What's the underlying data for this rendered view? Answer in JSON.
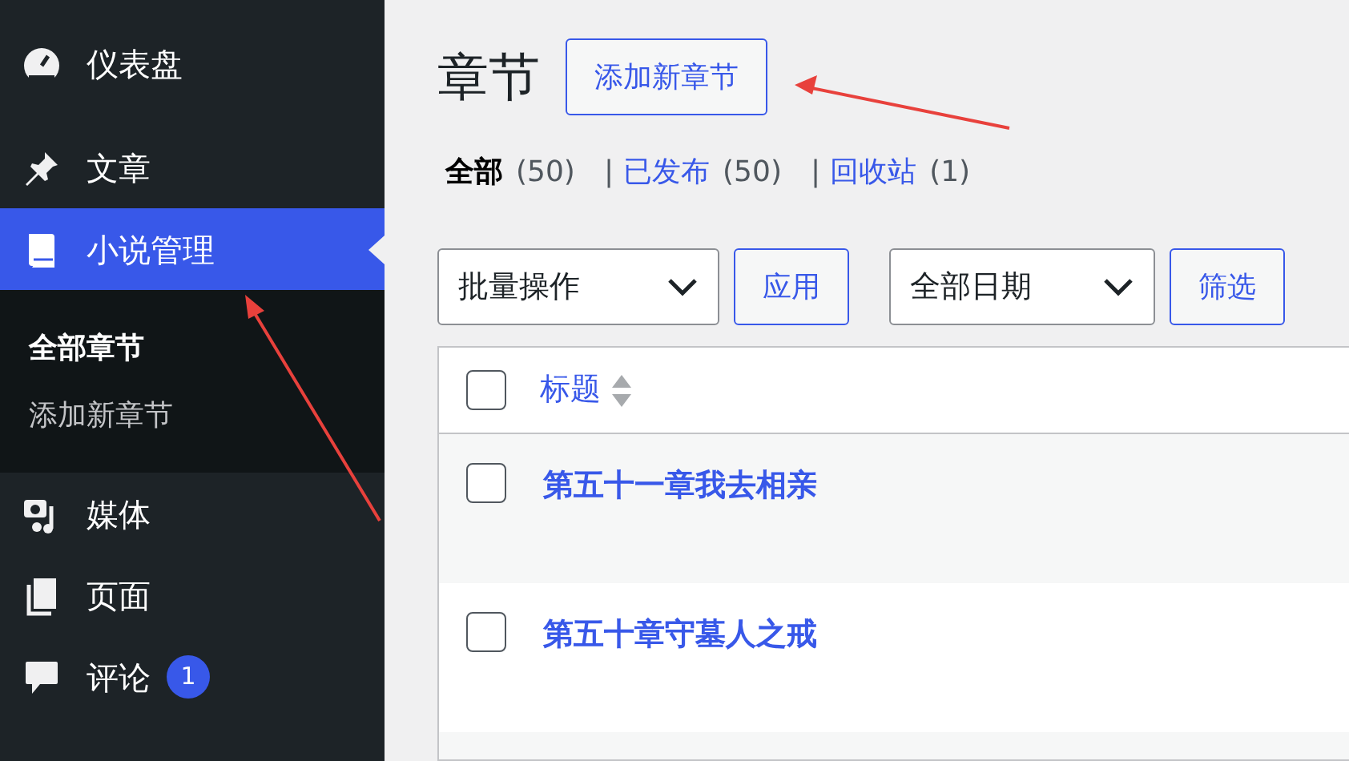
{
  "sidebar": {
    "items": [
      {
        "label": "仪表盘",
        "kind": "dashboard",
        "selected": false
      },
      {
        "label": "文章",
        "kind": "pin",
        "selected": false
      },
      {
        "label": "小说管理",
        "kind": "book",
        "selected": true,
        "submenu": [
          {
            "label": "全部章节",
            "selected": true
          },
          {
            "label": "添加新章节",
            "selected": false
          }
        ]
      },
      {
        "label": "媒体",
        "kind": "media",
        "selected": false
      },
      {
        "label": "页面",
        "kind": "pages",
        "selected": false
      },
      {
        "label": "评论",
        "kind": "comment",
        "selected": false,
        "badge": "1"
      }
    ]
  },
  "page": {
    "title": "章节",
    "add_button": "添加新章节"
  },
  "views": [
    {
      "label": "全部",
      "count": "(50)",
      "selected": true
    },
    {
      "separator": "|",
      "label": "已发布",
      "count": "(50)",
      "selected": false
    },
    {
      "separator": "|",
      "label": "回收站",
      "count": "(1)",
      "selected": false
    }
  ],
  "bulk_actions": {
    "select": "批量操作",
    "button": "应用"
  },
  "date_filter": {
    "select": "全部日期",
    "button": "筛选"
  },
  "table": {
    "select_all_checked": false,
    "columns": [
      {
        "label": "标题"
      }
    ],
    "rows": [
      {
        "title": "第五十一章我去相亲",
        "checked": false
      },
      {
        "title": "第五十章守墓人之戒",
        "checked": false
      }
    ]
  }
}
